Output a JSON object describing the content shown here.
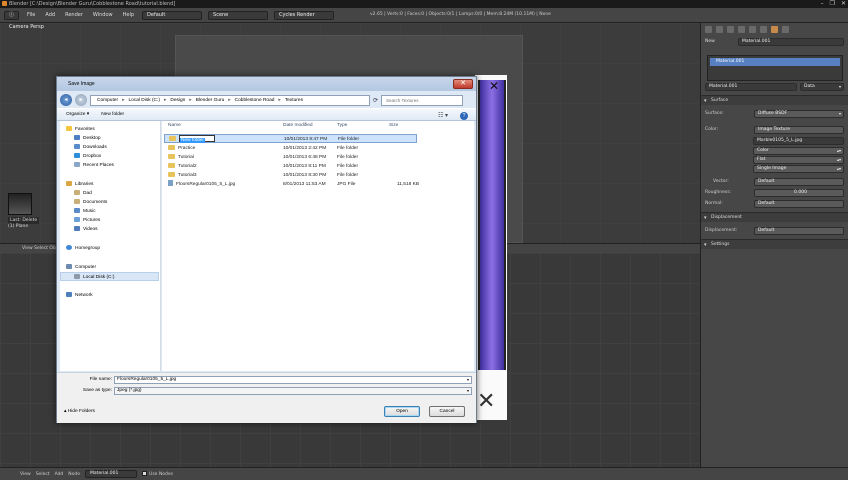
{
  "title_bar": {
    "title": "Blender [C:\\Design\\Blender Guru\\Cobblestone Road\\tutorial.blend]",
    "controls": [
      "–",
      "❐",
      "✕"
    ]
  },
  "blender_header": {
    "menus": [
      "File",
      "Add",
      "Render",
      "Window",
      "Help"
    ],
    "layout": "Default",
    "scene": "Scene",
    "engine": "Cycles Render",
    "stats": "v2.65 | Verts:0 | Faces:0 | Objects:0/1 | Lamps:0/0 | Mem:8.24M (10.11M) | None"
  },
  "viewport": {
    "label": "Camera Persp",
    "tool_tag": "Last: Delete",
    "sub_tag": "(1) Plane"
  },
  "view3d_header": "View   Select   Object",
  "node_header": {
    "menus": [
      "View",
      "Select",
      "Add",
      "Node"
    ],
    "material": "Material.001",
    "use_nodes": "Use Nodes"
  },
  "properties": {
    "new_btn": "New",
    "material_name_top": "Material.001",
    "material_list_item": "Material.001",
    "material_field": "Material.001",
    "data_dropdown": "Data",
    "surface_panel": "Surface",
    "surface_label": "Surface:",
    "surface_value": "Diffuse BSDF",
    "color_label": "Color:",
    "color_value": "Image Texture",
    "image_name": "Marble0105_5_L.jpg",
    "color_mode": "Color",
    "projection": "Flat",
    "source": "Single Image",
    "vector_label": "Vector:",
    "vector_value": "Default",
    "roughness_label": "Roughness:",
    "roughness_value": "0.000",
    "normal_label": "Normal:",
    "normal_value": "Default",
    "displacement_panel": "Displacement",
    "displacement_label": "Displacement:",
    "displacement_value": "Default",
    "settings_panel": "Settings"
  },
  "dialog": {
    "title": "Save Image",
    "breadcrumb": [
      "Computer",
      "Local Disk (C:)",
      "Design",
      "Blender Guru",
      "Cobblestone Road",
      "Textures"
    ],
    "search_placeholder": "Search Textures",
    "toolbar": {
      "organize": "Organize ▾",
      "new_folder": "New folder"
    },
    "nav": {
      "favorites": "Favorites",
      "fav_items": [
        "Desktop",
        "Downloads",
        "Dropbox",
        "Recent Places"
      ],
      "libraries": "Libraries",
      "lib_items": [
        "Dad",
        "Documents",
        "Music",
        "Pictures",
        "Videos"
      ],
      "homegroup": "Homegroup",
      "computer": "Computer",
      "local_disk": "Local Disk (C:)",
      "network": "Network"
    },
    "columns": {
      "name": "Name",
      "date": "Date modified",
      "type": "Type",
      "size": "Size"
    },
    "files": [
      {
        "name": "New folder",
        "date": "10/01/2013 8:47 PM",
        "type": "File folder",
        "size": ""
      },
      {
        "name": "Practice",
        "date": "10/01/2013 2:42 PM",
        "type": "File folder",
        "size": ""
      },
      {
        "name": "Tutorial",
        "date": "10/01/2013 6:48 PM",
        "type": "File folder",
        "size": ""
      },
      {
        "name": "Tutorial2",
        "date": "10/01/2013 8:11 PM",
        "type": "File folder",
        "size": ""
      },
      {
        "name": "Tutorial3",
        "date": "10/01/2013 8:30 PM",
        "type": "File folder",
        "size": ""
      },
      {
        "name": "FloorsRegular0105_5_L.jpg",
        "date": "8/01/2013 11:53 AM",
        "type": "JPG File",
        "size": "11,518 KB"
      }
    ],
    "file_name_label": "File name:",
    "file_name_value": "FloorsRegular0105_5_L.jpg",
    "save_type_label": "Save as type:",
    "save_type_value": "Jpeg (*.jpg)",
    "hide_folders": "Hide Folders",
    "open_btn": "Open",
    "cancel_btn": "Cancel"
  }
}
